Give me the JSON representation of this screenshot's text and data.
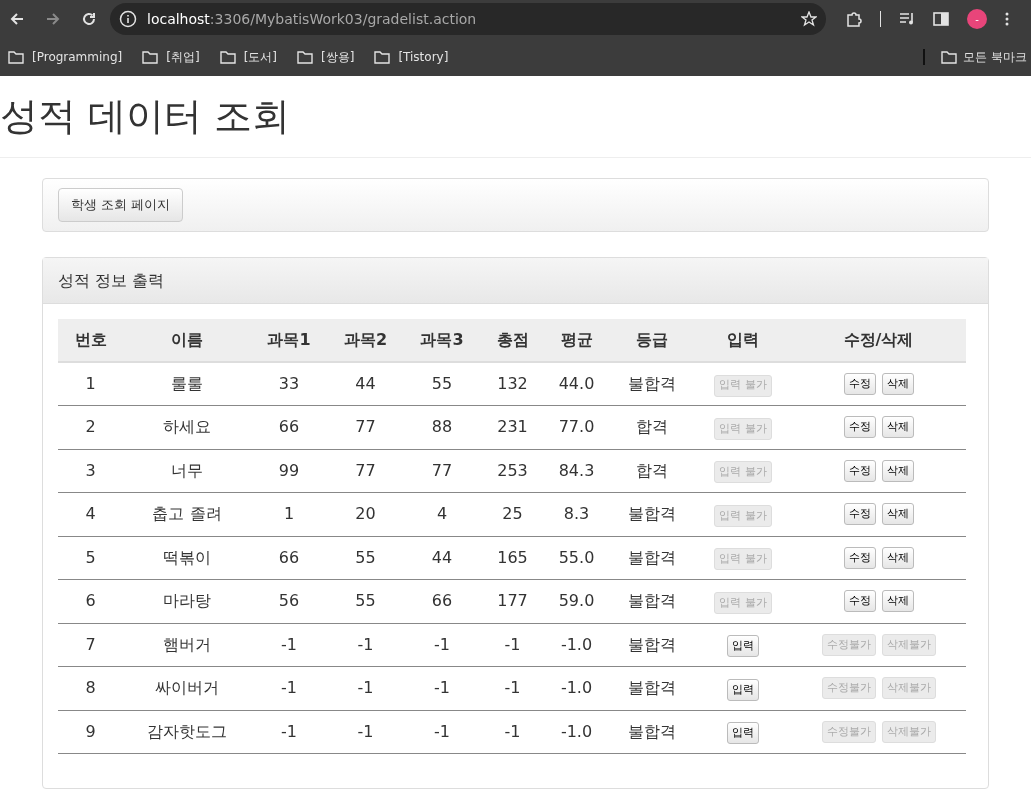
{
  "browser": {
    "url_host": "localhost",
    "url_rest": ":3306/MybatisWork03/gradelist.action",
    "bookmarks": [
      "[Programming]",
      "[취업]",
      "[도서]",
      "[쌍용]",
      "[Tistory]"
    ],
    "all_bookmarks": "모든 북마크",
    "profile_initial": "-"
  },
  "page": {
    "title": "성적 데이터 조회",
    "nav_button": "학생 조회 페이지"
  },
  "panel": {
    "heading": "성적 정보 출력",
    "table": {
      "columns": [
        "번호",
        "이름",
        "과목1",
        "과목2",
        "과목3",
        "총점",
        "평균",
        "등급",
        "입력",
        "수정/삭제"
      ],
      "rows": [
        {
          "cells": [
            "1",
            "룰룰",
            "33",
            "44",
            "55",
            "132",
            "44.0",
            "불합격"
          ],
          "input": {
            "label": "입력 불가",
            "disabled": true
          },
          "edit": {
            "label": "수정",
            "disabled": false
          },
          "delete": {
            "label": "삭제",
            "disabled": false
          }
        },
        {
          "cells": [
            "2",
            "하세요",
            "66",
            "77",
            "88",
            "231",
            "77.0",
            "합격"
          ],
          "input": {
            "label": "입력 불가",
            "disabled": true
          },
          "edit": {
            "label": "수정",
            "disabled": false
          },
          "delete": {
            "label": "삭제",
            "disabled": false
          }
        },
        {
          "cells": [
            "3",
            "너무",
            "99",
            "77",
            "77",
            "253",
            "84.3",
            "합격"
          ],
          "input": {
            "label": "입력 불가",
            "disabled": true
          },
          "edit": {
            "label": "수정",
            "disabled": false
          },
          "delete": {
            "label": "삭제",
            "disabled": false
          }
        },
        {
          "cells": [
            "4",
            "춥고 졸려",
            "1",
            "20",
            "4",
            "25",
            "8.3",
            "불합격"
          ],
          "input": {
            "label": "입력 불가",
            "disabled": true
          },
          "edit": {
            "label": "수정",
            "disabled": false
          },
          "delete": {
            "label": "삭제",
            "disabled": false
          }
        },
        {
          "cells": [
            "5",
            "떡볶이",
            "66",
            "55",
            "44",
            "165",
            "55.0",
            "불합격"
          ],
          "input": {
            "label": "입력 불가",
            "disabled": true
          },
          "edit": {
            "label": "수정",
            "disabled": false
          },
          "delete": {
            "label": "삭제",
            "disabled": false
          }
        },
        {
          "cells": [
            "6",
            "마라탕",
            "56",
            "55",
            "66",
            "177",
            "59.0",
            "불합격"
          ],
          "input": {
            "label": "입력 불가",
            "disabled": true
          },
          "edit": {
            "label": "수정",
            "disabled": false
          },
          "delete": {
            "label": "삭제",
            "disabled": false
          }
        },
        {
          "cells": [
            "7",
            "햄버거",
            "-1",
            "-1",
            "-1",
            "-1",
            "-1.0",
            "불합격"
          ],
          "input": {
            "label": "입력",
            "disabled": false
          },
          "edit": {
            "label": "수정불가",
            "disabled": true
          },
          "delete": {
            "label": "삭제불가",
            "disabled": true
          }
        },
        {
          "cells": [
            "8",
            "싸이버거",
            "-1",
            "-1",
            "-1",
            "-1",
            "-1.0",
            "불합격"
          ],
          "input": {
            "label": "입력",
            "disabled": false
          },
          "edit": {
            "label": "수정불가",
            "disabled": true
          },
          "delete": {
            "label": "삭제불가",
            "disabled": true
          }
        },
        {
          "cells": [
            "9",
            "감자핫도그",
            "-1",
            "-1",
            "-1",
            "-1",
            "-1.0",
            "불합격"
          ],
          "input": {
            "label": "입력",
            "disabled": false
          },
          "edit": {
            "label": "수정불가",
            "disabled": true
          },
          "delete": {
            "label": "삭제불가",
            "disabled": true
          }
        }
      ]
    }
  }
}
